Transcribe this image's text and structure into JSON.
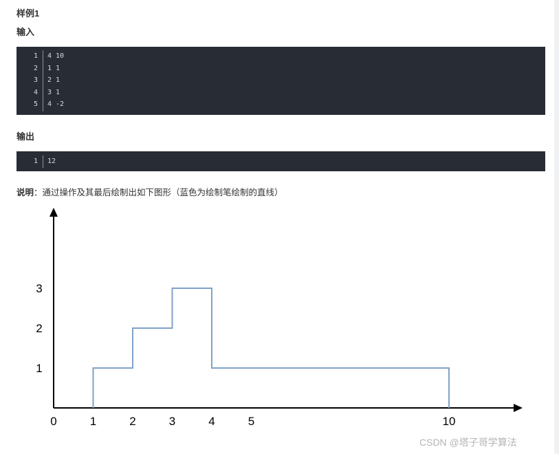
{
  "example_title": "样例1",
  "input_label": "输入",
  "input_lines": [
    {
      "no": "1",
      "text": "4 10"
    },
    {
      "no": "2",
      "text": "1 1"
    },
    {
      "no": "3",
      "text": "2 1"
    },
    {
      "no": "4",
      "text": "3 1"
    },
    {
      "no": "5",
      "text": "4 -2"
    }
  ],
  "output_label": "输出",
  "output_lines": [
    {
      "no": "1",
      "text": "12"
    }
  ],
  "description": {
    "label": "说明",
    "separator": "：",
    "text": "通过操作及其最后绘制出如下图形（蓝色为绘制笔绘制的直线）"
  },
  "chart_data": {
    "type": "line",
    "step": true,
    "x_ticks": [
      "0",
      "1",
      "2",
      "3",
      "4",
      "5",
      "10"
    ],
    "y_ticks": [
      "1",
      "2",
      "3"
    ],
    "series": [
      {
        "points": [
          [
            1,
            0
          ],
          [
            1,
            1
          ],
          [
            2,
            1
          ],
          [
            2,
            2
          ],
          [
            3,
            2
          ],
          [
            3,
            3
          ],
          [
            4,
            3
          ],
          [
            4,
            1
          ],
          [
            10,
            1
          ],
          [
            10,
            0
          ]
        ],
        "color": "#7fa2c8"
      }
    ],
    "axis_color": "#000000"
  },
  "watermark": "CSDN @塔子哥学算法"
}
